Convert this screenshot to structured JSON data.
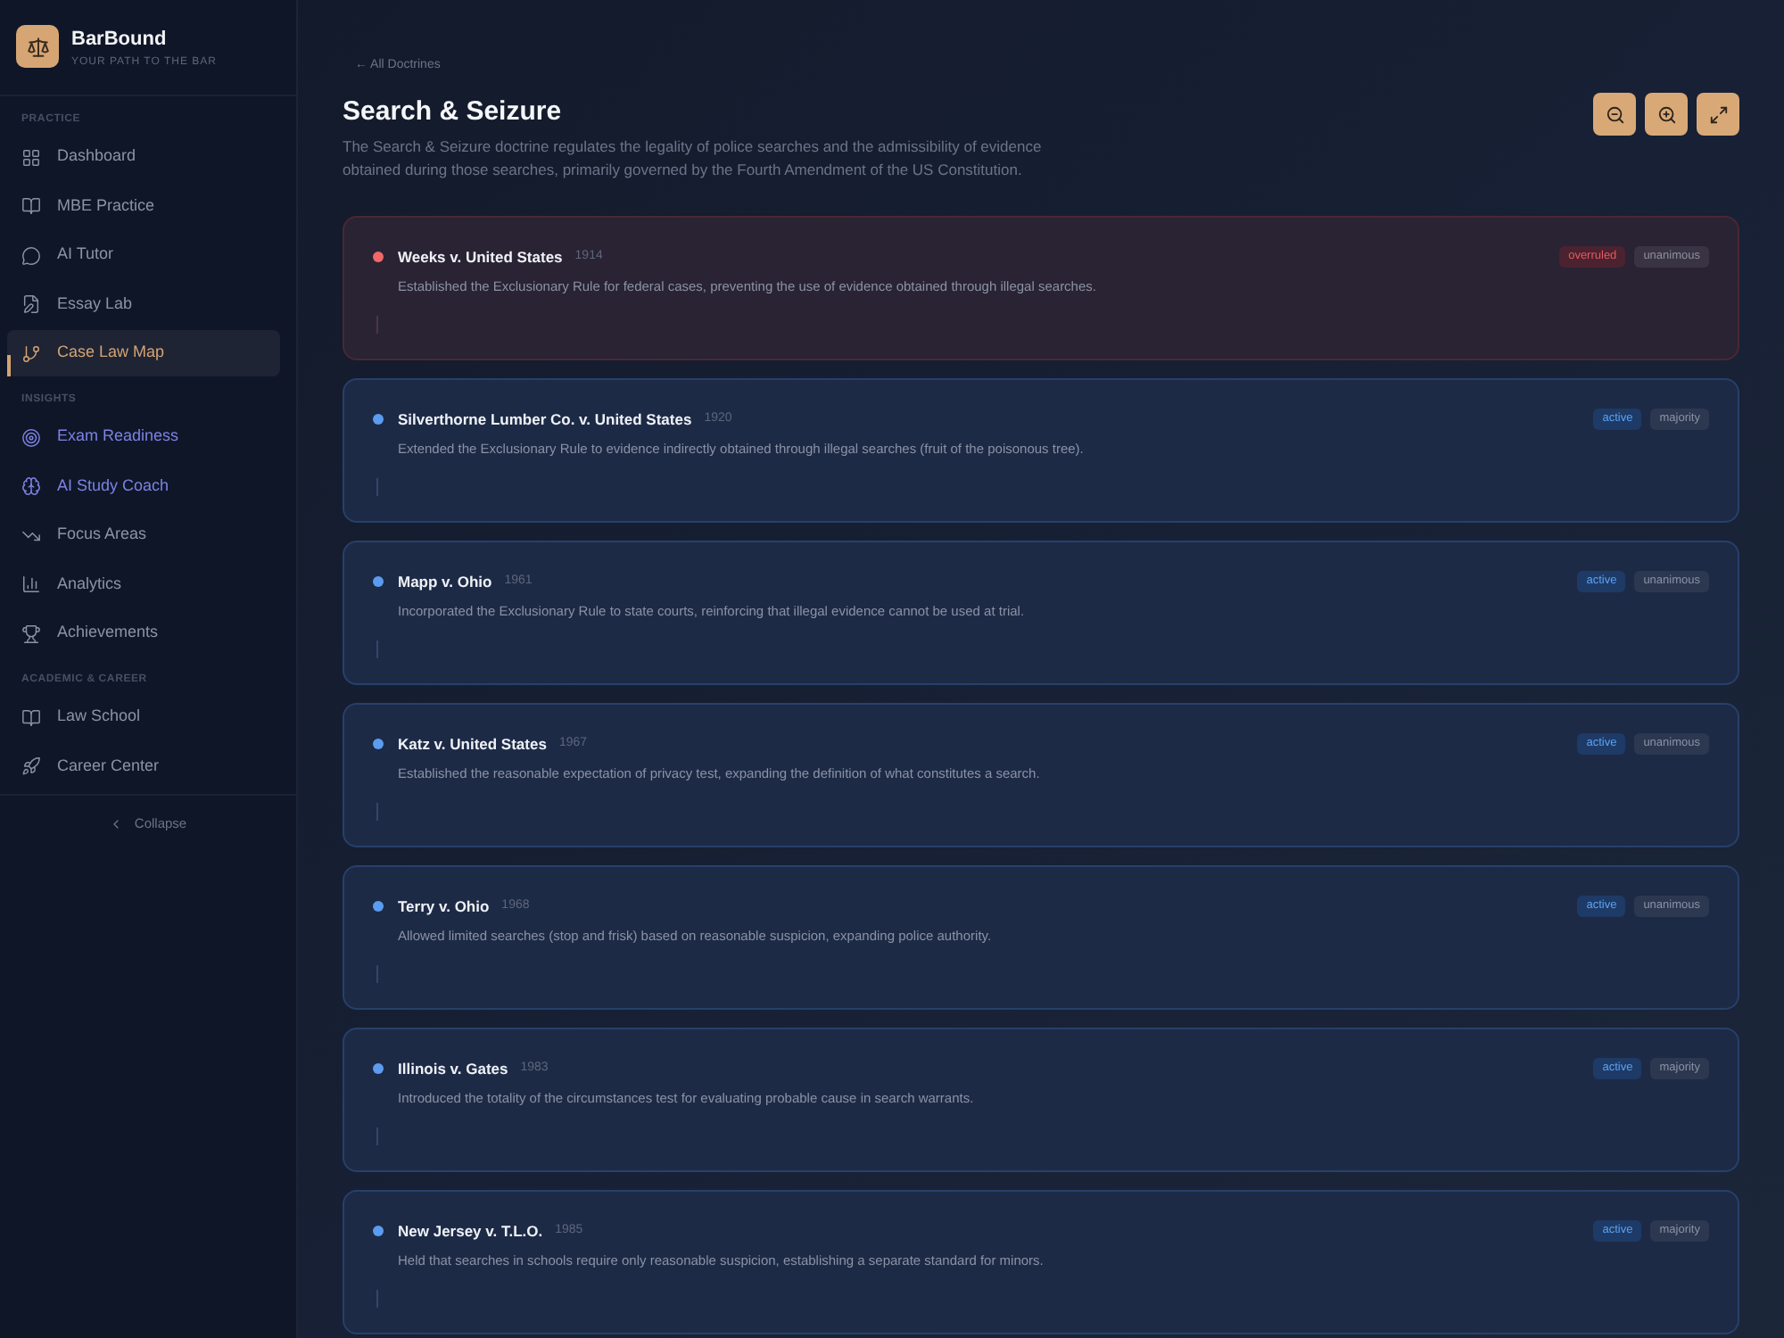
{
  "sidebar": {
    "brand": {
      "name": "BarBound",
      "tagline": "YOUR PATH TO THE BAR"
    },
    "sections": [
      {
        "title": "PRACTICE",
        "items": [
          {
            "label": "Dashboard",
            "selected": false,
            "highlighted": false
          },
          {
            "label": "MBE Practice",
            "selected": false,
            "highlighted": false
          },
          {
            "label": "AI Tutor",
            "selected": false,
            "highlighted": false
          },
          {
            "label": "Essay Lab",
            "selected": false,
            "highlighted": false
          },
          {
            "label": "Case Law Map",
            "selected": true,
            "highlighted": false
          }
        ]
      },
      {
        "title": "INSIGHTS",
        "items": [
          {
            "label": "Exam Readiness",
            "selected": false,
            "highlighted": true
          },
          {
            "label": "AI Study Coach",
            "selected": false,
            "highlighted": true
          },
          {
            "label": "Focus Areas",
            "selected": false,
            "highlighted": false
          },
          {
            "label": "Analytics",
            "selected": false,
            "highlighted": false
          },
          {
            "label": "Achievements",
            "selected": false,
            "highlighted": false
          }
        ]
      },
      {
        "title": "ACADEMIC & CAREER",
        "items": [
          {
            "label": "Law School",
            "selected": false,
            "highlighted": false
          },
          {
            "label": "Career Center",
            "selected": false,
            "highlighted": false
          }
        ]
      }
    ],
    "collapse_label": "Collapse"
  },
  "page": {
    "back_link": "← All Doctrines",
    "title": "Search & Seizure",
    "description": "The Search & Seizure doctrine regulates the legality of police searches and the admissibility of evidence obtained during those searches, primarily governed by the Fourth Amendment of the US Constitution."
  },
  "cases": [
    {
      "name": "Weeks v. United States",
      "year": "1914",
      "summary": "Established the Exclusionary Rule for federal cases, preventing the use of evidence obtained through illegal searches.",
      "status": "overruled",
      "opinion": "unanimous",
      "overruled": true
    },
    {
      "name": "Silverthorne Lumber Co. v. United States",
      "year": "1920",
      "summary": "Extended the Exclusionary Rule to evidence indirectly obtained through illegal searches (fruit of the poisonous tree).",
      "status": "active",
      "opinion": "majority",
      "overruled": false
    },
    {
      "name": "Mapp v. Ohio",
      "year": "1961",
      "summary": "Incorporated the Exclusionary Rule to state courts, reinforcing that illegal evidence cannot be used at trial.",
      "status": "active",
      "opinion": "unanimous",
      "overruled": false
    },
    {
      "name": "Katz v. United States",
      "year": "1967",
      "summary": "Established the reasonable expectation of privacy test, expanding the definition of what constitutes a search.",
      "status": "active",
      "opinion": "unanimous",
      "overruled": false
    },
    {
      "name": "Terry v. Ohio",
      "year": "1968",
      "summary": "Allowed limited searches (stop and frisk) based on reasonable suspicion, expanding police authority.",
      "status": "active",
      "opinion": "unanimous",
      "overruled": false
    },
    {
      "name": "Illinois v. Gates",
      "year": "1983",
      "summary": "Introduced the totality of the circumstances test for evaluating probable cause in search warrants.",
      "status": "active",
      "opinion": "majority",
      "overruled": false
    },
    {
      "name": "New Jersey v. T.L.O.",
      "year": "1985",
      "summary": "Held that searches in schools require only reasonable suspicion, establishing a separate standard for minors.",
      "status": "active",
      "opinion": "majority",
      "overruled": false
    }
  ]
}
